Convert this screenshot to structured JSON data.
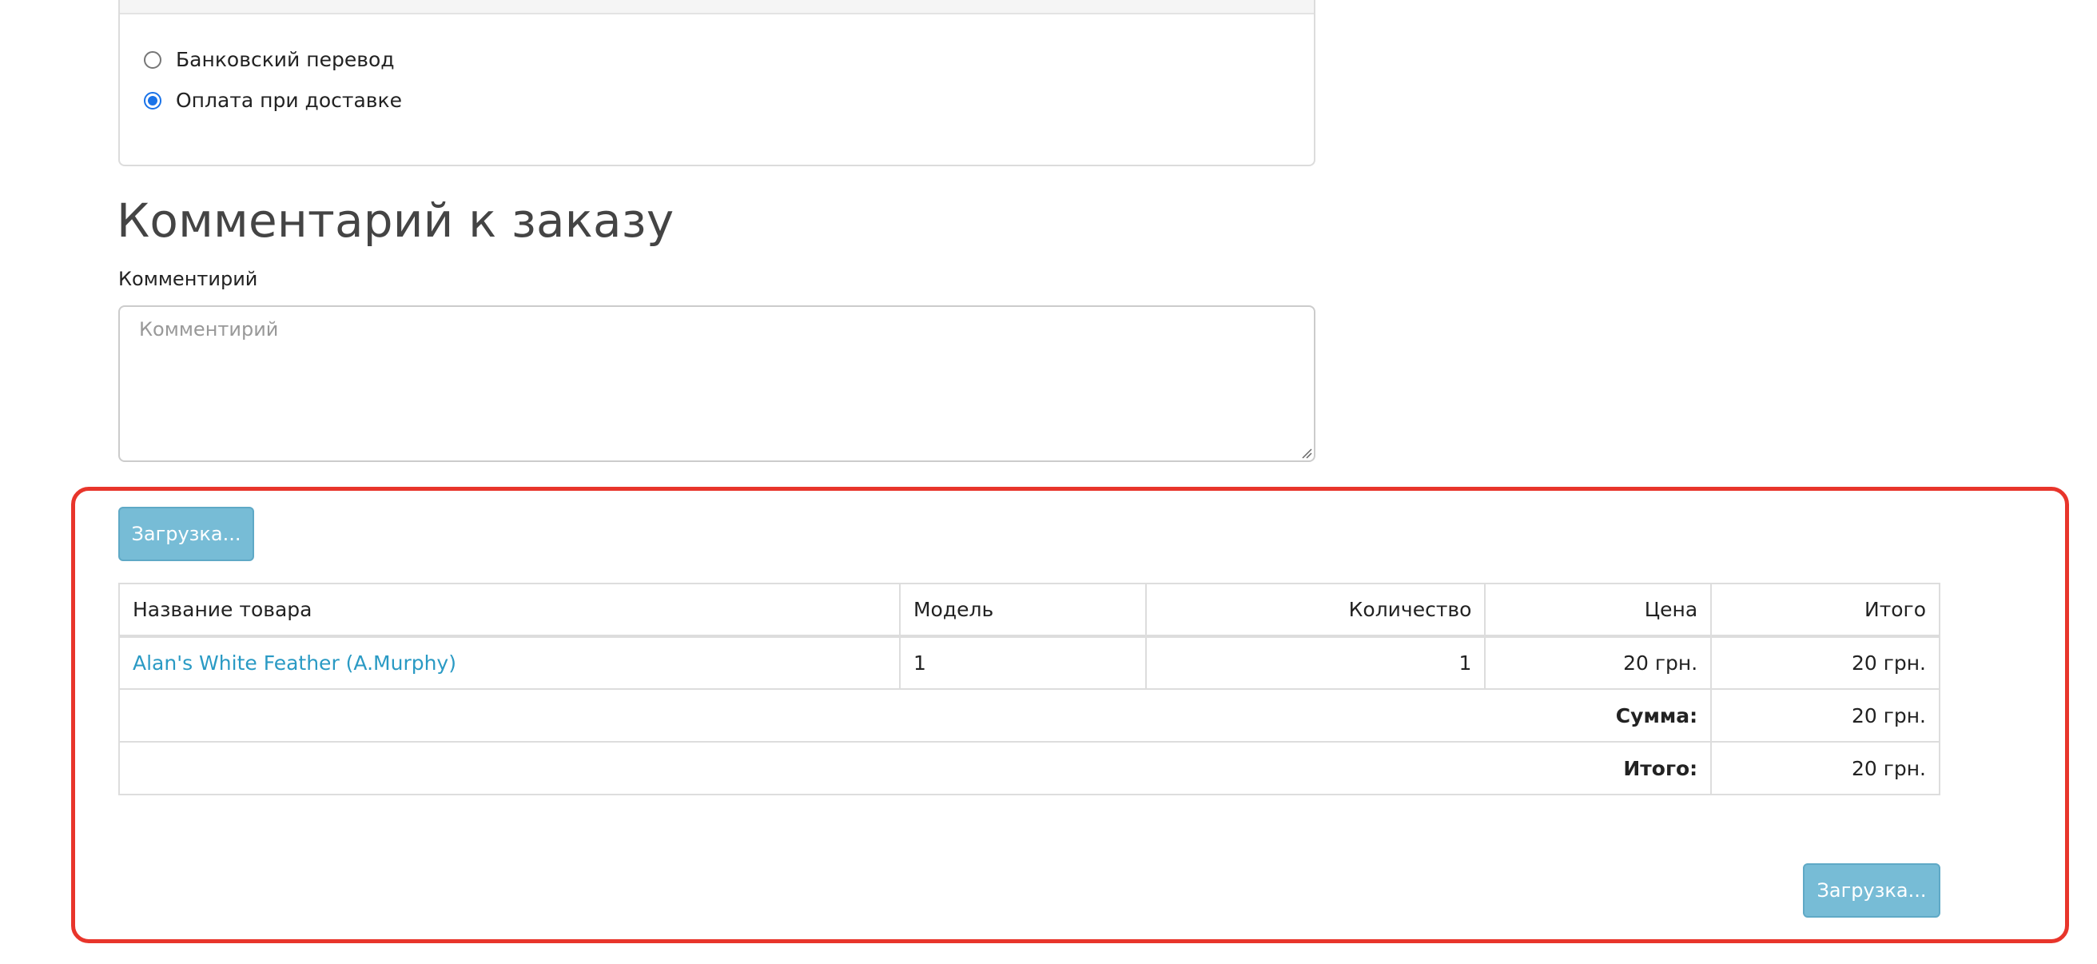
{
  "payment": {
    "options": [
      {
        "label": "Банковский перевод",
        "checked": false
      },
      {
        "label": "Оплата при доставке",
        "checked": true
      }
    ]
  },
  "comment_section": {
    "title": "Комментарий к заказу",
    "label": "Комментирий",
    "placeholder": "Комментирий",
    "value": ""
  },
  "buttons": {
    "top_label": "Загрузка...",
    "bottom_label": "Загрузка..."
  },
  "cart_table": {
    "headers": {
      "name": "Название товара",
      "model": "Модель",
      "quantity": "Количество",
      "price": "Цена",
      "total": "Итого"
    },
    "rows": [
      {
        "name": "Alan's White Feather (A.Murphy)",
        "model": "1",
        "quantity": "1",
        "price": "20 грн.",
        "total": "20 грн."
      }
    ],
    "totals": [
      {
        "label": "Сумма:",
        "value": "20 грн."
      },
      {
        "label": "Итого:",
        "value": "20 грн."
      }
    ]
  },
  "colors": {
    "accent_link": "#2a9ac4",
    "button_bg": "#77bcd6",
    "highlight_border": "#e8352b",
    "radio_checked": "#1a73e8"
  }
}
